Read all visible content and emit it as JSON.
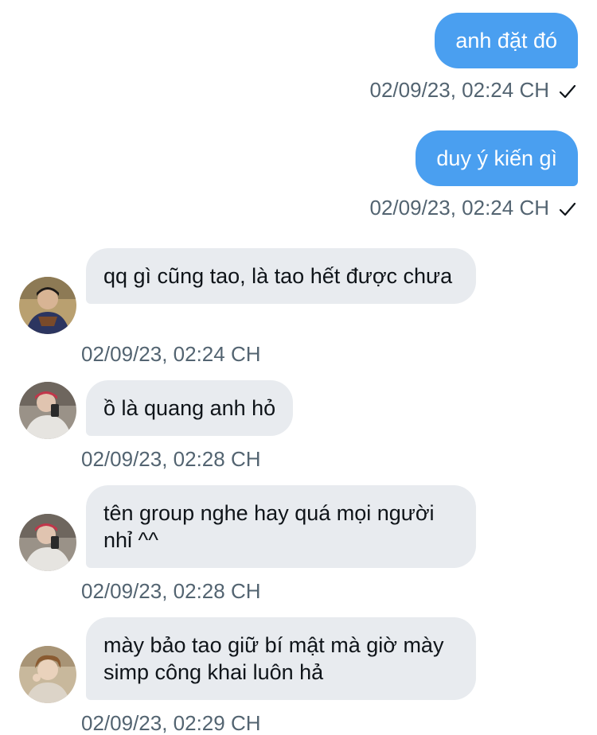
{
  "messages": [
    {
      "direction": "outgoing",
      "text": "anh đặt đó",
      "timestamp": "02/09/23, 02:24 CH",
      "status_icon": "checkmark-icon"
    },
    {
      "direction": "outgoing",
      "text": "duy ý kiến gì",
      "timestamp": "02/09/23, 02:24 CH",
      "status_icon": "checkmark-icon"
    },
    {
      "direction": "incoming",
      "text": "qq gì cũng tao, là tao hết được chưa",
      "timestamp": "02/09/23, 02:24 CH",
      "avatar": "user-avatar-1"
    },
    {
      "direction": "incoming",
      "text": "ồ là quang anh hỏ",
      "timestamp": "02/09/23, 02:28 CH",
      "avatar": "user-avatar-2"
    },
    {
      "direction": "incoming",
      "text": "tên group nghe hay quá mọi người nhỉ ^^",
      "timestamp": "02/09/23, 02:28 CH",
      "avatar": "user-avatar-2"
    },
    {
      "direction": "incoming",
      "text": "mày bảo tao giữ bí mật mà giờ mày simp công khai luôn hả",
      "timestamp": "02/09/23, 02:29 CH",
      "avatar": "user-avatar-3"
    }
  ],
  "colors": {
    "outgoing_bubble": "#4a9ff0",
    "incoming_bubble": "#e8ebef",
    "timestamp_text": "#536471"
  }
}
